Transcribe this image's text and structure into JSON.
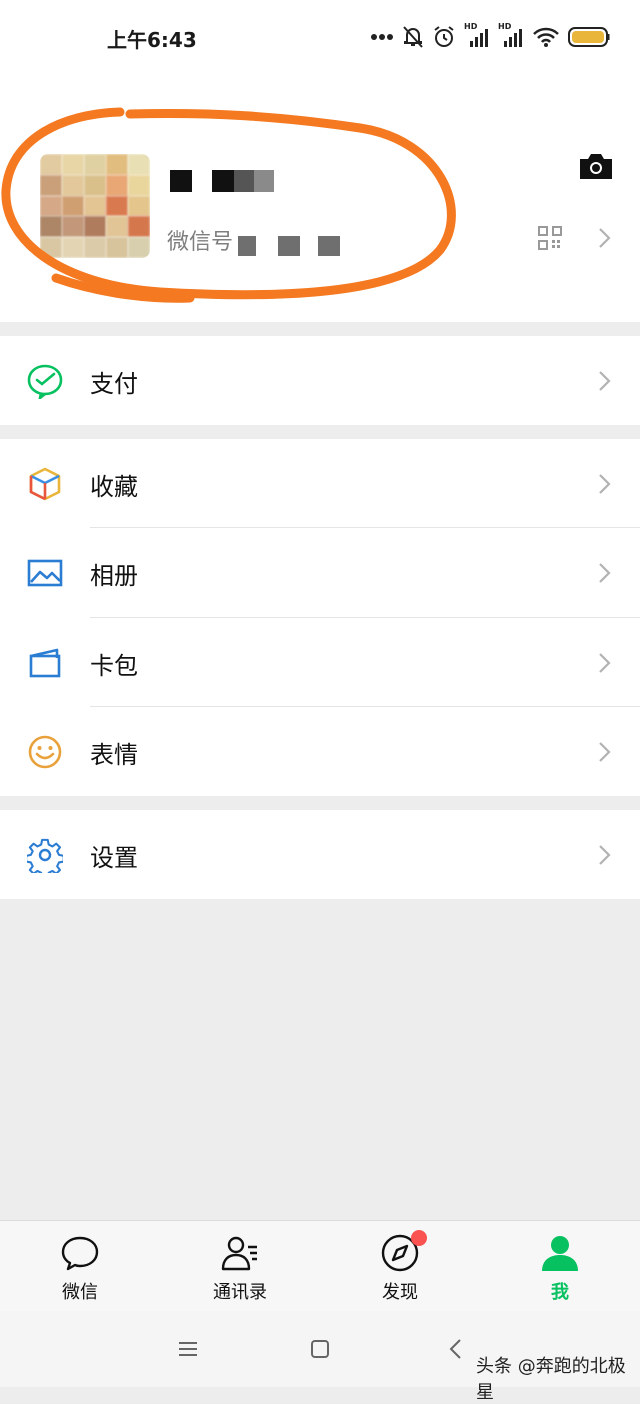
{
  "status_bar": {
    "time": "上午6:43",
    "hd1": "HD",
    "hd2": "HD"
  },
  "profile": {
    "wxid_label": "微信号",
    "avatar_colors": [
      "#e2cba0",
      "#e8d6a6",
      "#e0d1a2",
      "#e1be7f",
      "#e8dfb4",
      "#caa07a",
      "#e2c89a",
      "#d9c08b",
      "#e8a774",
      "#e9d69d",
      "#d5a887",
      "#cf9f72",
      "#e3c493",
      "#d9794f",
      "#e4c58c",
      "#ac8666",
      "#c2977a",
      "#b07c5e",
      "#e1c596",
      "#d5774d",
      "#d9c7a3",
      "#e3d5b3",
      "#dccba8",
      "#d8c49c",
      "#d8cfae"
    ]
  },
  "menu": {
    "pay": {
      "label": "支付",
      "icon": "pay-icon"
    },
    "favorites": {
      "label": "收藏",
      "icon": "cube-icon"
    },
    "album": {
      "label": "相册",
      "icon": "image-icon"
    },
    "cards": {
      "label": "卡包",
      "icon": "wallet-icon"
    },
    "stickers": {
      "label": "表情",
      "icon": "smile-icon"
    },
    "settings": {
      "label": "设置",
      "icon": "gear-icon"
    }
  },
  "tabbar": {
    "tabs": [
      {
        "label": "微信",
        "icon": "chat-icon",
        "active": false
      },
      {
        "label": "通讯录",
        "icon": "contacts-icon",
        "active": false
      },
      {
        "label": "发现",
        "icon": "compass-icon",
        "active": false,
        "badge": true
      },
      {
        "label": "我",
        "icon": "person-icon",
        "active": true
      }
    ]
  },
  "colors": {
    "accent": "#07c160",
    "badge": "#fa5151",
    "annotation": "#f47920",
    "background": "#ededed"
  },
  "watermark": "头条 @奔跑的北极星"
}
